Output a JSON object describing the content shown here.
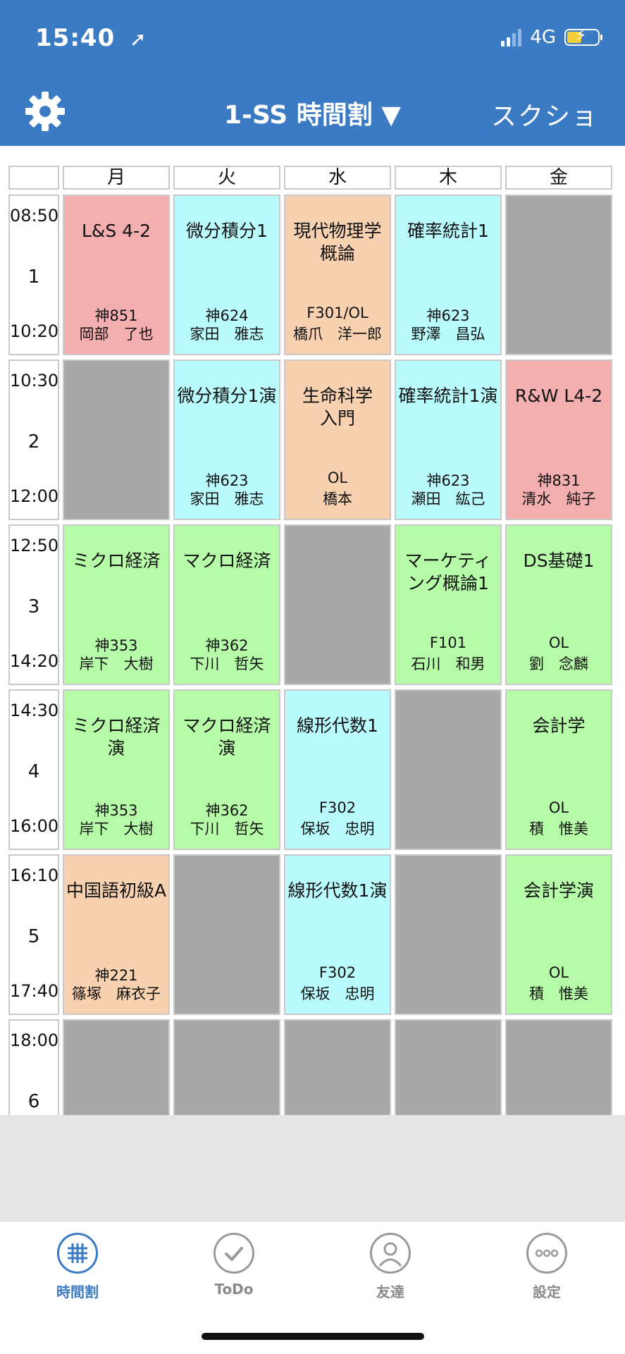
{
  "status_bar": {
    "time": "15:40",
    "network": "4G"
  },
  "header": {
    "title": "1-SS 時間割 ▼",
    "screenshot_label": "スクショ"
  },
  "days": [
    "月",
    "火",
    "水",
    "木",
    "金"
  ],
  "periods": [
    {
      "start": "08:50",
      "num": "1",
      "end": "10:20"
    },
    {
      "start": "10:30",
      "num": "2",
      "end": "12:00"
    },
    {
      "start": "12:50",
      "num": "3",
      "end": "14:20"
    },
    {
      "start": "14:30",
      "num": "4",
      "end": "16:00"
    },
    {
      "start": "16:10",
      "num": "5",
      "end": "17:40"
    },
    {
      "start": "18:00",
      "num": "6",
      "end": ""
    }
  ],
  "colors": {
    "header": "#3b7bc4",
    "pink": "#f3aeb0",
    "cyan": "#b9fbfd",
    "peach": "#f8d1b0",
    "green": "#b6fca8",
    "empty": "#a8a8a8"
  },
  "timetable": [
    [
      {
        "name": "L&S 4-2",
        "room": "神851",
        "teacher": "岡部　了也",
        "color": "pink"
      },
      {
        "name": "微分積分1",
        "room": "神624",
        "teacher": "家田　雅志",
        "color": "cyan"
      },
      {
        "name": "現代物理学\n概論",
        "room": "F301/OL",
        "teacher": "橋爪　洋一郎",
        "color": "peach"
      },
      {
        "name": "確率統計1",
        "room": "神623",
        "teacher": "野澤　昌弘",
        "color": "cyan"
      },
      {
        "color": "gray"
      }
    ],
    [
      {
        "color": "gray"
      },
      {
        "name": "微分積分1演",
        "room": "神623",
        "teacher": "家田　雅志",
        "color": "cyan"
      },
      {
        "name": "生命科学\n入門",
        "room": "OL",
        "teacher": "橋本",
        "color": "peach"
      },
      {
        "name": "確率統計1演",
        "room": "神623",
        "teacher": "瀬田　紘己",
        "color": "cyan"
      },
      {
        "name": "R&W L4-2",
        "room": "神831",
        "teacher": "清水　純子",
        "color": "pink"
      }
    ],
    [
      {
        "name": "ミクロ経済",
        "room": "神353",
        "teacher": "岸下　大樹",
        "color": "green"
      },
      {
        "name": "マクロ経済",
        "room": "神362",
        "teacher": "下川　哲矢",
        "color": "green"
      },
      {
        "color": "gray"
      },
      {
        "name": "マーケティ\nング概論1",
        "room": "F101",
        "teacher": "石川　和男",
        "color": "green"
      },
      {
        "name": "DS基礎1",
        "room": "OL",
        "teacher": "劉　念麟",
        "color": "green"
      }
    ],
    [
      {
        "name": "ミクロ経済\n演",
        "room": "神353",
        "teacher": "岸下　大樹",
        "color": "green"
      },
      {
        "name": "マクロ経済\n演",
        "room": "神362",
        "teacher": "下川　哲矢",
        "color": "green"
      },
      {
        "name": "線形代数1",
        "room": "F302",
        "teacher": "保坂　忠明",
        "color": "cyan"
      },
      {
        "color": "gray"
      },
      {
        "name": "会計学",
        "room": "OL",
        "teacher": "積　惟美",
        "color": "green"
      }
    ],
    [
      {
        "name": "中国語初級A",
        "room": "神221",
        "teacher": "篠塚　麻衣子",
        "color": "peach"
      },
      {
        "color": "gray"
      },
      {
        "name": "線形代数1演",
        "room": "F302",
        "teacher": "保坂　忠明",
        "color": "cyan"
      },
      {
        "color": "gray"
      },
      {
        "name": "会計学演",
        "room": "OL",
        "teacher": "積　惟美",
        "color": "green"
      }
    ],
    [
      {
        "color": "gray"
      },
      {
        "color": "gray"
      },
      {
        "color": "gray"
      },
      {
        "color": "gray"
      },
      {
        "color": "gray"
      }
    ]
  ],
  "tabs": [
    {
      "label": "時間割",
      "icon": "grid-icon",
      "active": true
    },
    {
      "label": "ToDo",
      "icon": "check-icon",
      "active": false
    },
    {
      "label": "友達",
      "icon": "person-icon",
      "active": false
    },
    {
      "label": "設定",
      "icon": "more-icon",
      "active": false
    }
  ]
}
